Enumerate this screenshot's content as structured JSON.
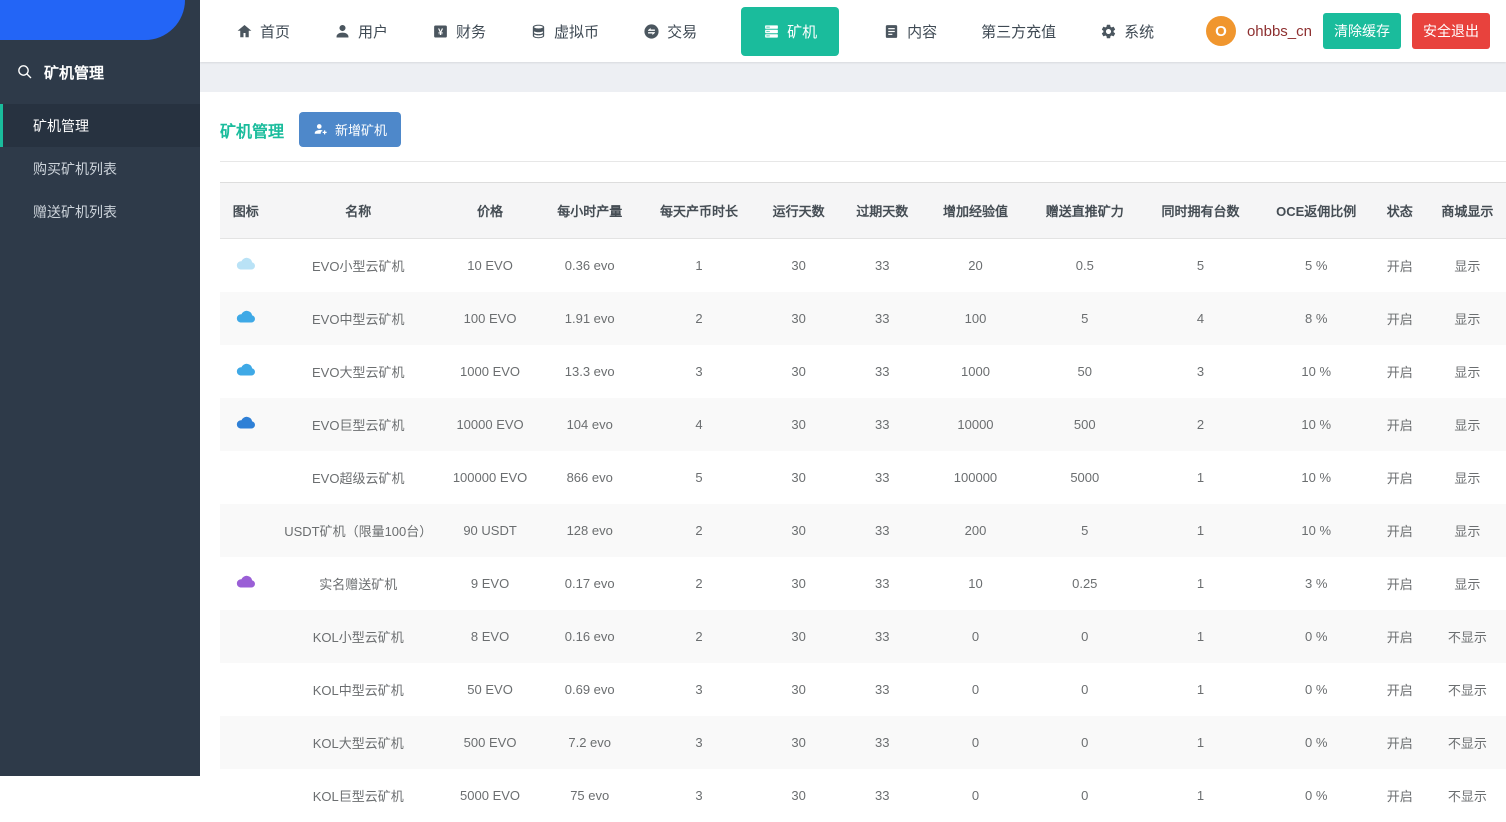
{
  "navbar": {
    "items": [
      {
        "label": "首页",
        "icon": "home-icon",
        "active": false
      },
      {
        "label": "用户",
        "icon": "user-icon",
        "active": false
      },
      {
        "label": "财务",
        "icon": "finance-icon",
        "active": false
      },
      {
        "label": "虚拟币",
        "icon": "coins-icon",
        "active": false
      },
      {
        "label": "交易",
        "icon": "exchange-icon",
        "active": false
      },
      {
        "label": "矿机",
        "icon": "server-icon",
        "active": true
      },
      {
        "label": "内容",
        "icon": "content-icon",
        "active": false
      },
      {
        "label": "第三方充值",
        "icon": "",
        "active": false
      },
      {
        "label": "系统",
        "icon": "gear-icon",
        "active": false
      }
    ],
    "user": {
      "avatar_letter": "O",
      "username": "ohbbs_cn"
    },
    "clear_cache_label": "清除缓存",
    "logout_label": "安全退出"
  },
  "sidebar": {
    "title": "矿机管理",
    "items": [
      {
        "label": "矿机管理",
        "active": true
      },
      {
        "label": "购买矿机列表",
        "active": false
      },
      {
        "label": "赠送矿机列表",
        "active": false
      }
    ]
  },
  "main": {
    "page_title": "矿机管理",
    "add_button_label": "新增矿机",
    "table": {
      "columns": [
        "图标",
        "名称",
        "价格",
        "每小时产量",
        "每天产币时长",
        "运行天数",
        "过期天数",
        "增加经验值",
        "赠送直推矿力",
        "同时拥有台数",
        "OCE返佣比例",
        "状态",
        "商城显示"
      ],
      "rows": [
        {
          "icon_color": "#b9e2f6",
          "name": "EVO小型云矿机",
          "price": "10 EVO",
          "hourly_output": "0.36 evo",
          "daily_coin_hours": "1",
          "run_days": "30",
          "expire_days": "33",
          "exp_gain": "20",
          "gift_power": "0.5",
          "max_count": "5",
          "oce_rate": "5 %",
          "status": "开启",
          "mall_display": "显示"
        },
        {
          "icon_color": "#3fa9e6",
          "name": "EVO中型云矿机",
          "price": "100 EVO",
          "hourly_output": "1.91 evo",
          "daily_coin_hours": "2",
          "run_days": "30",
          "expire_days": "33",
          "exp_gain": "100",
          "gift_power": "5",
          "max_count": "4",
          "oce_rate": "8 %",
          "status": "开启",
          "mall_display": "显示"
        },
        {
          "icon_color": "#3fa9e6",
          "name": "EVO大型云矿机",
          "price": "1000 EVO",
          "hourly_output": "13.3 evo",
          "daily_coin_hours": "3",
          "run_days": "30",
          "expire_days": "33",
          "exp_gain": "1000",
          "gift_power": "50",
          "max_count": "3",
          "oce_rate": "10 %",
          "status": "开启",
          "mall_display": "显示"
        },
        {
          "icon_color": "#2f80d6",
          "name": "EVO巨型云矿机",
          "price": "10000 EVO",
          "hourly_output": "104 evo",
          "daily_coin_hours": "4",
          "run_days": "30",
          "expire_days": "33",
          "exp_gain": "10000",
          "gift_power": "500",
          "max_count": "2",
          "oce_rate": "10 %",
          "status": "开启",
          "mall_display": "显示"
        },
        {
          "icon_color": null,
          "name": "EVO超级云矿机",
          "price": "100000 EVO",
          "hourly_output": "866 evo",
          "daily_coin_hours": "5",
          "run_days": "30",
          "expire_days": "33",
          "exp_gain": "100000",
          "gift_power": "5000",
          "max_count": "1",
          "oce_rate": "10 %",
          "status": "开启",
          "mall_display": "显示"
        },
        {
          "icon_color": null,
          "name": "USDT矿机（限量100台）",
          "price": "90 USDT",
          "hourly_output": "128 evo",
          "daily_coin_hours": "2",
          "run_days": "30",
          "expire_days": "33",
          "exp_gain": "200",
          "gift_power": "5",
          "max_count": "1",
          "oce_rate": "10 %",
          "status": "开启",
          "mall_display": "显示"
        },
        {
          "icon_color": "#9a5fd6",
          "name": "实名赠送矿机",
          "price": "9 EVO",
          "hourly_output": "0.17 evo",
          "daily_coin_hours": "2",
          "run_days": "30",
          "expire_days": "33",
          "exp_gain": "10",
          "gift_power": "0.25",
          "max_count": "1",
          "oce_rate": "3 %",
          "status": "开启",
          "mall_display": "显示"
        },
        {
          "icon_color": null,
          "name": "KOL小型云矿机",
          "price": "8 EVO",
          "hourly_output": "0.16 evo",
          "daily_coin_hours": "2",
          "run_days": "30",
          "expire_days": "33",
          "exp_gain": "0",
          "gift_power": "0",
          "max_count": "1",
          "oce_rate": "0 %",
          "status": "开启",
          "mall_display": "不显示"
        },
        {
          "icon_color": null,
          "name": "KOL中型云矿机",
          "price": "50 EVO",
          "hourly_output": "0.69 evo",
          "daily_coin_hours": "3",
          "run_days": "30",
          "expire_days": "33",
          "exp_gain": "0",
          "gift_power": "0",
          "max_count": "1",
          "oce_rate": "0 %",
          "status": "开启",
          "mall_display": "不显示"
        },
        {
          "icon_color": null,
          "name": "KOL大型云矿机",
          "price": "500 EVO",
          "hourly_output": "7.2 evo",
          "daily_coin_hours": "3",
          "run_days": "30",
          "expire_days": "33",
          "exp_gain": "0",
          "gift_power": "0",
          "max_count": "1",
          "oce_rate": "0 %",
          "status": "开启",
          "mall_display": "不显示"
        },
        {
          "icon_color": null,
          "name": "KOL巨型云矿机",
          "price": "5000 EVO",
          "hourly_output": "75 evo",
          "daily_coin_hours": "3",
          "run_days": "30",
          "expire_days": "33",
          "exp_gain": "0",
          "gift_power": "0",
          "max_count": "1",
          "oce_rate": "0 %",
          "status": "开启",
          "mall_display": "不显示"
        }
      ]
    }
  },
  "colors": {
    "accent_green": "#1abc9c",
    "logout_red": "#e8423d",
    "avatar_orange": "#f0962e",
    "add_button_blue": "#4e88ca",
    "logo_blue": "#2365f6",
    "sidebar_bg": "#2e3a49",
    "username_text": "#8e3030"
  }
}
